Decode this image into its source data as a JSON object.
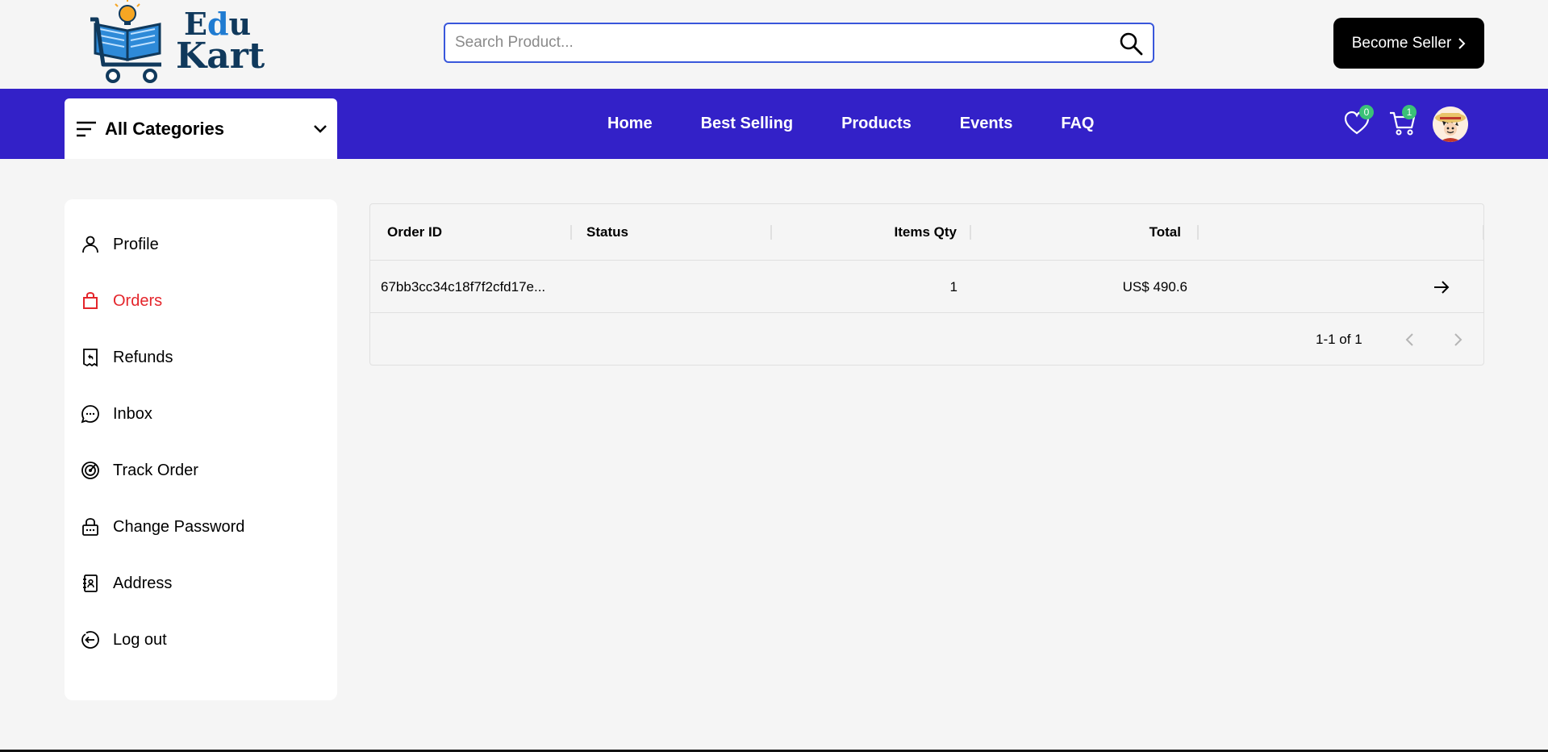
{
  "brand": {
    "line1_a": "E",
    "line1_b": "d",
    "line1_c": "u",
    "line2": "Kart"
  },
  "search": {
    "placeholder": "Search Product..."
  },
  "header": {
    "become_seller_label": "Become Seller"
  },
  "nav": {
    "categories_label": "All Categories",
    "links": [
      "Home",
      "Best Selling",
      "Products",
      "Events",
      "FAQ"
    ],
    "wishlist_count": "0",
    "cart_count": "1"
  },
  "sidebar": {
    "active": "Orders",
    "items": [
      {
        "label": "Profile",
        "icon": "person-icon"
      },
      {
        "label": "Orders",
        "icon": "shopping-bag-icon"
      },
      {
        "label": "Refunds",
        "icon": "receipt-refund-icon"
      },
      {
        "label": "Inbox",
        "icon": "chat-bubble-icon"
      },
      {
        "label": "Track Order",
        "icon": "track-radar-icon"
      },
      {
        "label": "Change Password",
        "icon": "lock-icon"
      },
      {
        "label": "Address",
        "icon": "address-book-icon"
      },
      {
        "label": "Log out",
        "icon": "logout-icon"
      }
    ]
  },
  "orders_table": {
    "columns": [
      "Order ID",
      "Status",
      "Items Qty",
      "Total"
    ],
    "rows": [
      {
        "order_id": "67bb3cc34c18f7f2cfd17e...",
        "status": "",
        "items_qty": "1",
        "total": "US$ 490.6"
      }
    ],
    "pagination": "1-1 of 1"
  },
  "colors": {
    "nav_bg": "#3321c8",
    "active_item": "#e4252b",
    "search_border": "#3957db",
    "badge": "#3bc177",
    "button_bg": "#000000"
  }
}
